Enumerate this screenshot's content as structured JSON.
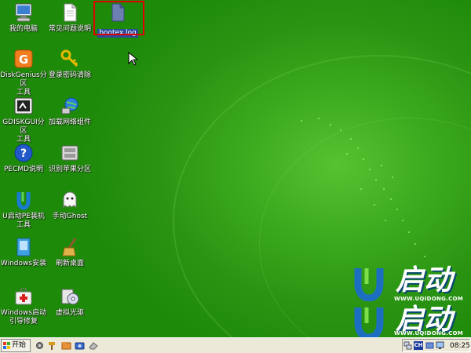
{
  "desktop": {
    "icons": [
      {
        "label": "我的电脑",
        "icon": "computer-icon"
      },
      {
        "label": "常见问题说明",
        "icon": "text-document-icon"
      },
      {
        "label": "bootex.log",
        "icon": "log-file-icon",
        "selected": true
      },
      {
        "label": "DiskGenius分区\n工具",
        "icon": "diskgenius-icon"
      },
      {
        "label": "登录密码清除",
        "icon": "key-icon"
      },
      {
        "label": "GDISKGUI分区\n工具",
        "icon": "gdiskgui-icon"
      },
      {
        "label": "加载网络组件",
        "icon": "network-globe-icon"
      },
      {
        "label": "PECMD说明",
        "icon": "help-icon"
      },
      {
        "label": "识别苹果分区",
        "icon": "apple-partition-icon"
      },
      {
        "label": "U启动PE装机\n工具",
        "icon": "uqidong-installer-icon"
      },
      {
        "label": "手动Ghost",
        "icon": "ghost-icon"
      },
      {
        "label": "Windows安装",
        "icon": "windows-setup-icon"
      },
      {
        "label": "刷新桌面",
        "icon": "broom-icon"
      },
      {
        "label": "Windows启动\n引导修复",
        "icon": "first-aid-kit-icon"
      },
      {
        "label": "虚拟光驱",
        "icon": "cd-drive-icon"
      }
    ],
    "logo": {
      "brand": "启动",
      "url": "WWW.UQIDONG.COM"
    }
  },
  "taskbar": {
    "start_label": "开始",
    "quicklaunch": [
      "gear-icon",
      "hammer-icon",
      "folder-icon",
      "camera-icon",
      "eraser-icon"
    ],
    "tray": {
      "ime": "CH",
      "clock": "08:25"
    }
  }
}
